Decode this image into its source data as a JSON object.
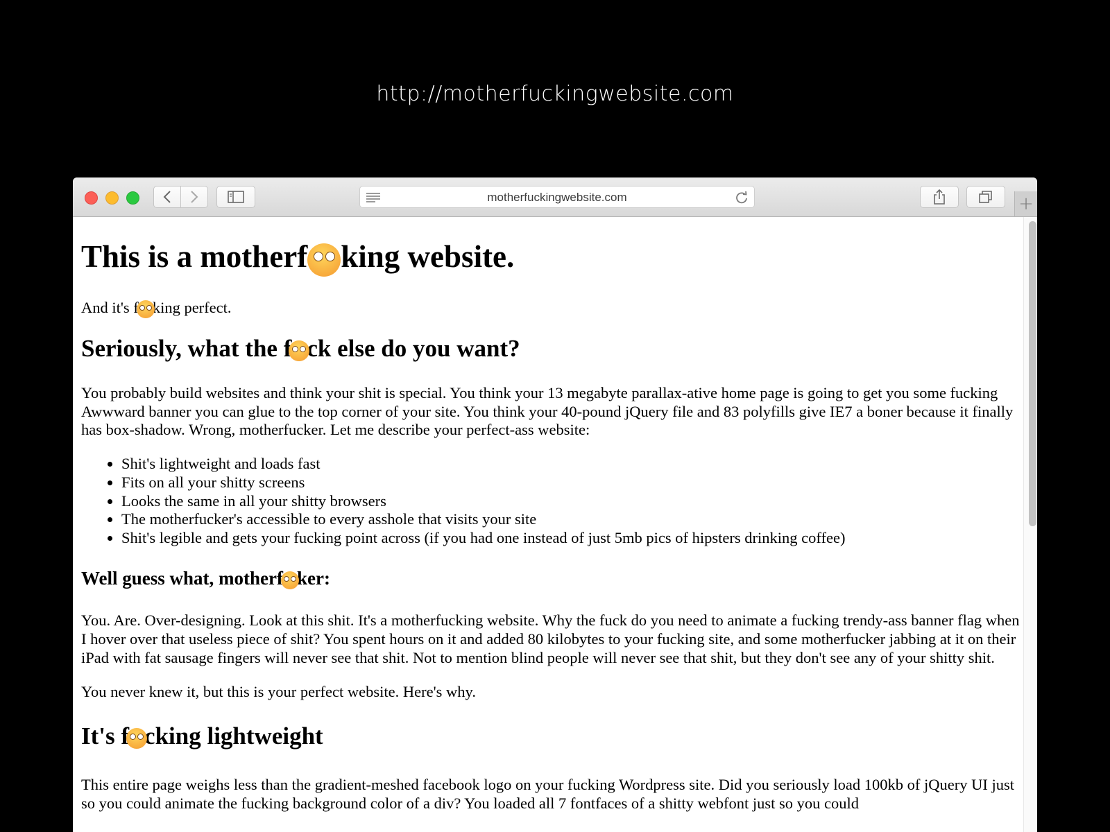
{
  "caption": "http://motherfuckingwebsite.com",
  "browser": {
    "address": "motherfuckingwebsite.com",
    "new_tab_label": "+"
  },
  "page": {
    "h1": {
      "before": "This is a motherf",
      "after": "king website."
    },
    "intro": {
      "before": "And it's f",
      "after": "king perfect."
    },
    "h2_1": {
      "before": "Seriously, what the f",
      "after": "ck else do you want?"
    },
    "p1": "You probably build websites and think your shit is special. You think your 13 megabyte parallax-ative home page is going to get you some fucking Awwward banner you can glue to the top corner of your site. You think your 40-pound jQuery file and 83 polyfills give IE7 a boner because it finally has box-shadow. Wrong, motherfucker. Let me describe your perfect-ass website:",
    "list": [
      "Shit's lightweight and loads fast",
      "Fits on all your shitty screens",
      "Looks the same in all your shitty browsers",
      "The motherfucker's accessible to every asshole that visits your site",
      "Shit's legible and gets your fucking point across (if you had one instead of just 5mb pics of hipsters drinking coffee)"
    ],
    "h3_1": {
      "before": "Well guess what, motherf",
      "after": "ker:"
    },
    "p2": "You. Are. Over-designing. Look at this shit. It's a motherfucking website. Why the fuck do you need to animate a fucking trendy-ass banner flag when I hover over that useless piece of shit? You spent hours on it and added 80 kilobytes to your fucking site, and some motherfucker jabbing at it on their iPad with fat sausage fingers will never see that shit. Not to mention blind people will never see that shit, but they don't see any of your shitty shit.",
    "p3": "You never knew it, but this is your perfect website. Here's why.",
    "h2_2": {
      "before": "It's f",
      "after": "cking lightweight"
    },
    "p4": "This entire page weighs less than the gradient-meshed facebook logo on your fucking Wordpress site. Did you seriously load 100kb of jQuery UI just so you could animate the fucking background color of a div? You loaded all 7 fontfaces of a shitty webfont just so you could"
  },
  "icons": {
    "back": "chevron-left-icon",
    "forward": "chevron-right-icon",
    "sidebar": "sidebar-icon",
    "reader": "reader-icon",
    "reload": "reload-icon",
    "share": "share-icon",
    "tabs": "tabs-icon",
    "emoji": "flushed-face-icon"
  },
  "colors": {
    "close": "#fc5f57",
    "minimize": "#fdbc2e",
    "zoom": "#2ac940"
  }
}
